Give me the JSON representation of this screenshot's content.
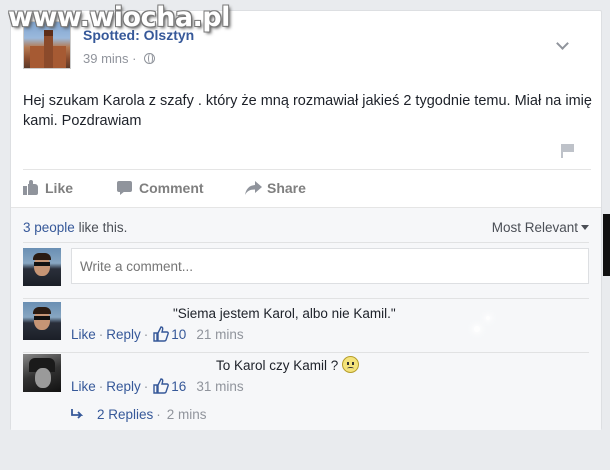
{
  "watermark": "www.wiocha.pl",
  "post": {
    "page_name": "Spotted: Olsztyn",
    "time": "39 mins",
    "text": "Hej szukam Karola z szafy . który że mną rozmawiał jakieś 2 tygodnie temu. Miał na imię kami. Pozdrawiam"
  },
  "actions": {
    "like": "Like",
    "comment": "Comment",
    "share": "Share"
  },
  "ufi": {
    "likes_link": "3 people",
    "likes_suffix": " like this.",
    "sort": "Most Relevant",
    "comment_placeholder": "Write a comment..."
  },
  "comments": [
    {
      "text": "\"Siema jestem Karol, albo nie Kamil.\"",
      "like": "Like",
      "reply": "Reply",
      "likes": "10",
      "time": "21 mins"
    },
    {
      "text": "To Karol czy Kamil ?",
      "like": "Like",
      "reply": "Reply",
      "likes": "16",
      "time": "31 mins"
    }
  ],
  "replies": {
    "label": "2 Replies",
    "time": "2 mins"
  },
  "colors": {
    "link": "#365899",
    "muted": "#90949c",
    "background": "#e9ebee"
  }
}
